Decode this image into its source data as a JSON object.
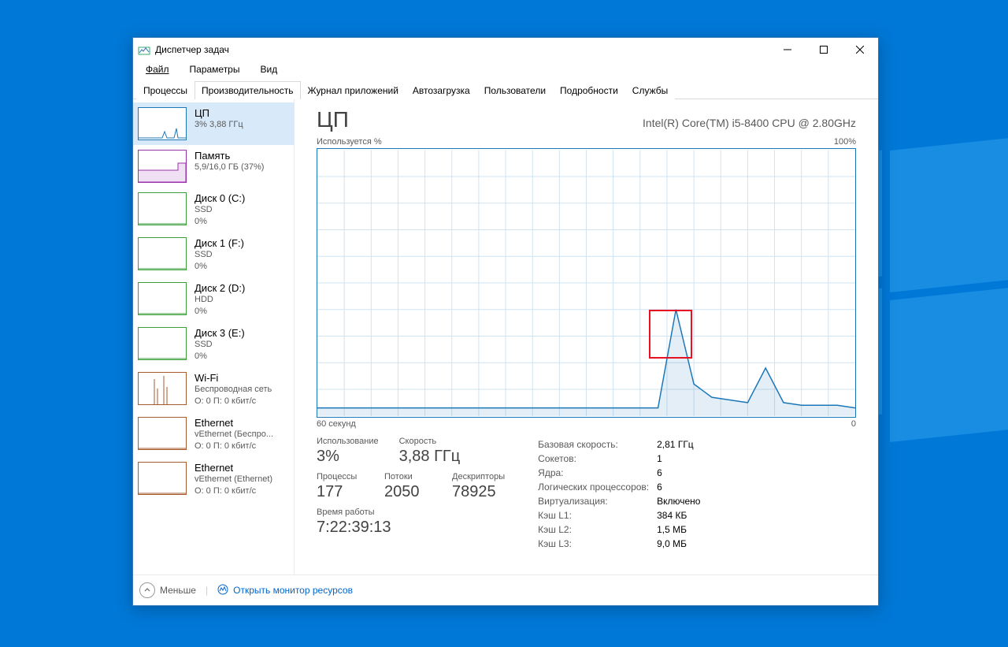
{
  "window": {
    "title": "Диспетчер задач"
  },
  "menu": {
    "file": "Файл",
    "options": "Параметры",
    "view": "Вид"
  },
  "tabs": [
    "Процессы",
    "Производительность",
    "Журнал приложений",
    "Автозагрузка",
    "Пользователи",
    "Подробности",
    "Службы"
  ],
  "active_tab_index": 1,
  "sidebar": [
    {
      "title": "ЦП",
      "sub1": "3% 3,88 ГГц",
      "color": "#1b77b8",
      "selected": true,
      "spark": "cpu"
    },
    {
      "title": "Память",
      "sub1": "5,9/16,0 ГБ (37%)",
      "color": "#9b2fae",
      "spark": "mem"
    },
    {
      "title": "Диск 0 (C:)",
      "sub1": "SSD",
      "sub2": "0%",
      "color": "#3b9e3b",
      "spark": "flat"
    },
    {
      "title": "Диск 1 (F:)",
      "sub1": "SSD",
      "sub2": "0%",
      "color": "#3b9e3b",
      "spark": "flat"
    },
    {
      "title": "Диск 2 (D:)",
      "sub1": "HDD",
      "sub2": "0%",
      "color": "#3b9e3b",
      "spark": "flat"
    },
    {
      "title": "Диск 3 (E:)",
      "sub1": "SSD",
      "sub2": "0%",
      "color": "#3b9e3b",
      "spark": "flat"
    },
    {
      "title": "Wi-Fi",
      "sub1": "Беспроводная сеть",
      "sub2": "О: 0 П: 0 кбит/с",
      "color": "#a65a2e",
      "spark": "wifi"
    },
    {
      "title": "Ethernet",
      "sub1": "vEthernet (Беспро...",
      "sub2": "О: 0 П: 0 кбит/с",
      "color": "#a65a2e",
      "spark": "flat"
    },
    {
      "title": "Ethernet",
      "sub1": "vEthernet (Ethernet)",
      "sub2": "О: 0 П: 0 кбит/с",
      "color": "#a65a2e",
      "spark": "flat"
    }
  ],
  "main": {
    "title": "ЦП",
    "subtitle": "Intel(R) Core(TM) i5-8400 CPU @ 2.80GHz",
    "y_label": "Используется %",
    "y_max": "100%",
    "x_left": "60 секунд",
    "x_right": "0"
  },
  "chart_data": {
    "type": "area",
    "title": "Используется %",
    "xlabel": "60 секунд → 0",
    "ylabel": "%",
    "ylim": [
      0,
      100
    ],
    "x_seconds": [
      60,
      58,
      56,
      54,
      52,
      50,
      48,
      46,
      44,
      42,
      40,
      38,
      36,
      34,
      32,
      30,
      28,
      26,
      24,
      22,
      20,
      18,
      16,
      14,
      12,
      10,
      8,
      6,
      4,
      2,
      0
    ],
    "values": [
      3,
      3,
      3,
      3,
      3,
      3,
      3,
      3,
      3,
      3,
      3,
      3,
      3,
      3,
      3,
      3,
      3,
      3,
      3,
      3,
      40,
      12,
      7,
      6,
      5,
      18,
      5,
      4,
      4,
      4,
      3
    ],
    "highlight_box": {
      "x_start_s": 23,
      "x_end_s": 18.5,
      "y_start": 23,
      "y_end": 40
    }
  },
  "stats_left": [
    [
      {
        "label": "Использование",
        "value": "3%"
      },
      {
        "label": "Скорость",
        "value": "3,88 ГГц"
      }
    ],
    [
      {
        "label": "Процессы",
        "value": "177"
      },
      {
        "label": "Потоки",
        "value": "2050"
      },
      {
        "label": "Дескрипторы",
        "value": "78925"
      }
    ],
    [
      {
        "label": "Время работы",
        "value": "7:22:39:13"
      }
    ]
  ],
  "stats_right": [
    {
      "label": "Базовая скорость:",
      "value": "2,81 ГГц"
    },
    {
      "label": "Сокетов:",
      "value": "1"
    },
    {
      "label": "Ядра:",
      "value": "6"
    },
    {
      "label": "Логических процессоров:",
      "value": "6"
    },
    {
      "label": "Виртуализация:",
      "value": "Включено"
    },
    {
      "label": "Кэш L1:",
      "value": "384 КБ"
    },
    {
      "label": "Кэш L2:",
      "value": "1,5 МБ"
    },
    {
      "label": "Кэш L3:",
      "value": "9,0 МБ"
    }
  ],
  "footer": {
    "less": "Меньше",
    "resmon": "Открыть монитор ресурсов"
  }
}
